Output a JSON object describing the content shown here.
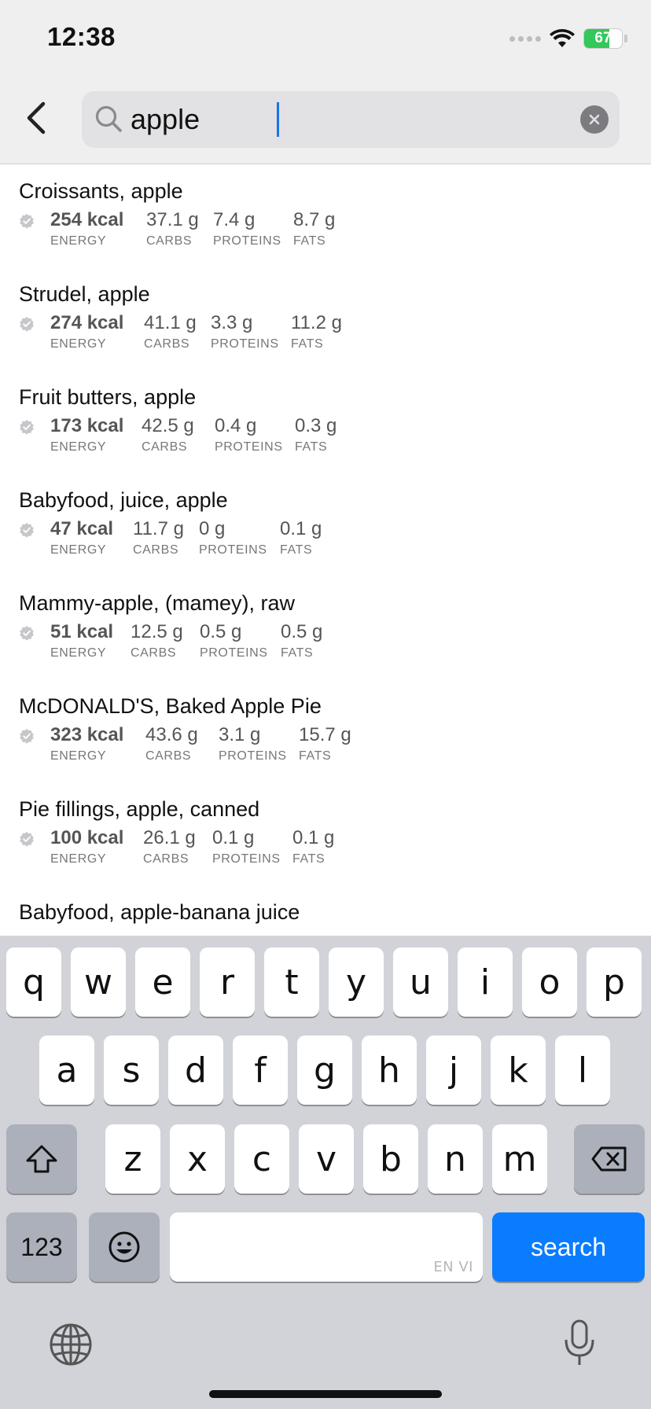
{
  "status_bar": {
    "time": "12:38",
    "battery_percent": "67",
    "battery_level": 0.67
  },
  "search": {
    "query": "apple",
    "placeholder": ""
  },
  "results": [
    {
      "name": "Croissants, apple",
      "energy": "254 kcal",
      "carbs": "37.1 g",
      "proteins": "7.4 g",
      "fats": "8.7 g"
    },
    {
      "name": "Strudel, apple",
      "energy": "274 kcal",
      "carbs": "41.1 g",
      "proteins": "3.3 g",
      "fats": "11.2 g"
    },
    {
      "name": "Fruit butters, apple",
      "energy": "173 kcal",
      "carbs": "42.5 g",
      "proteins": "0.4 g",
      "fats": "0.3 g"
    },
    {
      "name": "Babyfood, juice, apple",
      "energy": "47 kcal",
      "carbs": "11.7 g",
      "proteins": "0 g",
      "fats": "0.1 g"
    },
    {
      "name": "Mammy-apple, (mamey), raw",
      "energy": "51 kcal",
      "carbs": "12.5 g",
      "proteins": "0.5 g",
      "fats": "0.5 g"
    },
    {
      "name": "McDONALD'S, Baked Apple Pie",
      "energy": "323 kcal",
      "carbs": "43.6 g",
      "proteins": "3.1 g",
      "fats": "15.7 g"
    },
    {
      "name": "Pie fillings, apple, canned",
      "energy": "100 kcal",
      "carbs": "26.1 g",
      "proteins": "0.1 g",
      "fats": "0.1 g"
    },
    {
      "name": "Babyfood, apple-banana juice"
    }
  ],
  "labels": {
    "energy": "ENERGY",
    "carbs": "CARBS",
    "proteins": "PROTEINS",
    "fats": "FATS"
  },
  "keyboard": {
    "row1": [
      "q",
      "w",
      "e",
      "r",
      "t",
      "y",
      "u",
      "i",
      "o",
      "p"
    ],
    "row2": [
      "a",
      "s",
      "d",
      "f",
      "g",
      "h",
      "j",
      "k",
      "l"
    ],
    "row3": [
      "z",
      "x",
      "c",
      "v",
      "b",
      "n",
      "m"
    ],
    "numbers_key": "123",
    "search_key": "search",
    "space_hint": "EN VI"
  },
  "colors": {
    "accent": "#0a7cff",
    "battery": "#34c759"
  }
}
